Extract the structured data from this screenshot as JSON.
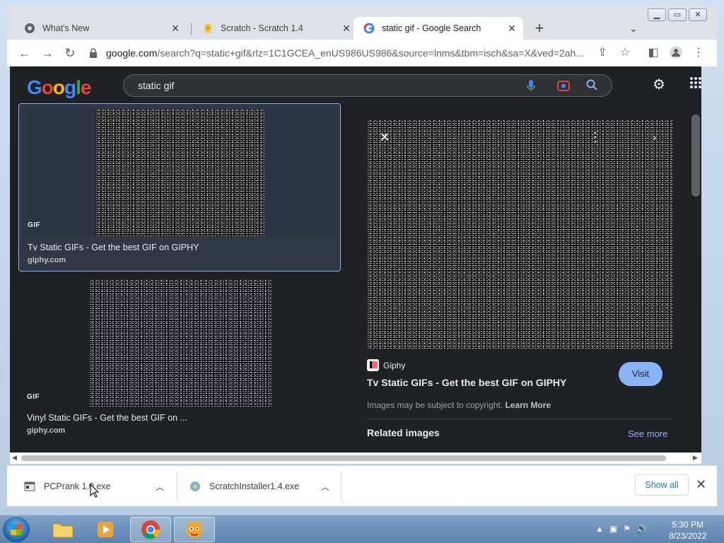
{
  "browser": {
    "tabs": [
      {
        "title": "What's New",
        "icon": "chrome-icon"
      },
      {
        "title": "Scratch - Scratch 1.4",
        "icon": "scratch-icon"
      },
      {
        "title": "static gif - Google Search",
        "icon": "google-icon"
      }
    ],
    "url_host": "google.com",
    "url_path": "/search?q=static+gif&rlz=1C1GCEA_enUS986US986&source=lnms&tbm=isch&sa=X&ved=2ah..."
  },
  "google": {
    "logo": "Google",
    "query": "static gif"
  },
  "results": [
    {
      "badge": "GIF",
      "title": "Tv Static GIFs - Get the best GIF on GIPHY",
      "source": "giphy.com"
    },
    {
      "badge": "GIF",
      "title": "Vinyl Static GIFs - Get the best GIF on ...",
      "source": "giphy.com"
    }
  ],
  "preview": {
    "source_name": "Giphy",
    "title": "Tv Static GIFs - Get the best GIF on GIPHY",
    "visit_label": "Visit",
    "copyright_text": "Images may be subject to copyright.",
    "learn_more": "Learn More",
    "related_label": "Related images",
    "see_more": "See more"
  },
  "downloads": {
    "items": [
      {
        "name": "PCPrank 1.0.exe"
      },
      {
        "name": "ScratchInstaller1.4.exe"
      }
    ],
    "show_all": "Show all"
  },
  "taskbar": {
    "time": "5:30 PM",
    "date": "8/23/2022"
  }
}
